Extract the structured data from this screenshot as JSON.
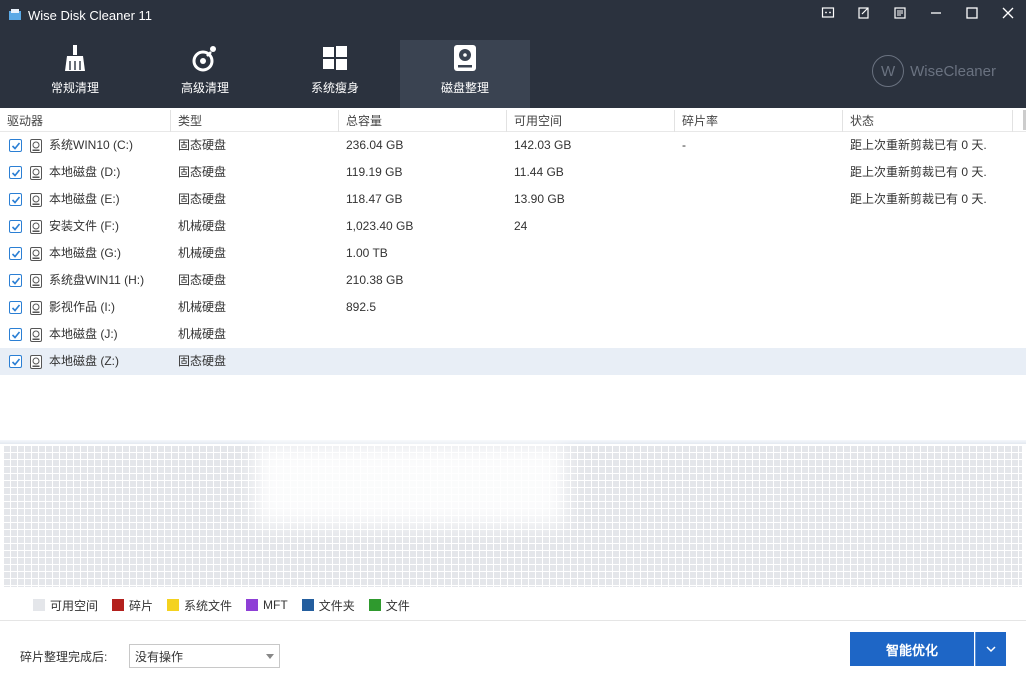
{
  "app": {
    "title": "Wise Disk Cleaner 11"
  },
  "brand": {
    "name": "WiseCleaner",
    "mark": "W"
  },
  "tabs": [
    {
      "label": "常规清理",
      "icon": "broom-icon",
      "active": false
    },
    {
      "label": "高级清理",
      "icon": "advanced-clean-icon",
      "active": false
    },
    {
      "label": "系统瘦身",
      "icon": "windows-logo-icon",
      "active": false
    },
    {
      "label": "磁盘整理",
      "icon": "disk-defrag-icon",
      "active": true
    }
  ],
  "table": {
    "headers": [
      "驱动器",
      "类型",
      "总容量",
      "可用空间",
      "碎片率",
      "状态"
    ],
    "rows": [
      {
        "drive": "系统WIN10 (C:)",
        "type": "固态硬盘",
        "total": "236.04 GB",
        "free": "142.03 GB",
        "frag": "-",
        "status": "距上次重新剪裁已有 0 天."
      },
      {
        "drive": "本地磁盘 (D:)",
        "type": "固态硬盘",
        "total": "119.19 GB",
        "free": "11.44 GB",
        "frag": "",
        "status": "距上次重新剪裁已有 0 天."
      },
      {
        "drive": "本地磁盘 (E:)",
        "type": "固态硬盘",
        "total": "118.47 GB",
        "free": "13.90 GB",
        "frag": "",
        "status": "距上次重新剪裁已有 0 天."
      },
      {
        "drive": "安装文件 (F:)",
        "type": "机械硬盘",
        "total": "1,023.40 GB",
        "free": "24",
        "frag": "",
        "status": ""
      },
      {
        "drive": "本地磁盘 (G:)",
        "type": "机械硬盘",
        "total": "1.00 TB",
        "free": "",
        "frag": "",
        "status": ""
      },
      {
        "drive": "系统盘WIN11 (H:)",
        "type": "固态硬盘",
        "total": "210.38 GB",
        "free": "",
        "frag": "",
        "status": ""
      },
      {
        "drive": "影视作品 (I:)",
        "type": "机械硬盘",
        "total": "892.5",
        "free": "",
        "frag": "",
        "status": ""
      },
      {
        "drive": "本地磁盘 (J:)",
        "type": "机械硬盘",
        "total": "",
        "free": "",
        "frag": "",
        "status": ""
      },
      {
        "drive": "本地磁盘 (Z:)",
        "type": "固态硬盘",
        "total": "",
        "free": "",
        "frag": "",
        "status": ""
      }
    ]
  },
  "legend": [
    {
      "label": "可用空间",
      "color": "#e4e6ea"
    },
    {
      "label": "碎片",
      "color": "#b3201d"
    },
    {
      "label": "系统文件",
      "color": "#f4d21f"
    },
    {
      "label": "MFT",
      "color": "#8e3fd6"
    },
    {
      "label": "文件夹",
      "color": "#245e9e"
    },
    {
      "label": "文件",
      "color": "#2f9a2e"
    }
  ],
  "footer": {
    "after_label": "碎片整理完成后:",
    "after_value": "没有操作",
    "optimize_label": "智能优化"
  },
  "colors": {
    "titlebar": "#2b323e",
    "accent": "#1e66c6",
    "checkbox": "#2b7fd4"
  }
}
